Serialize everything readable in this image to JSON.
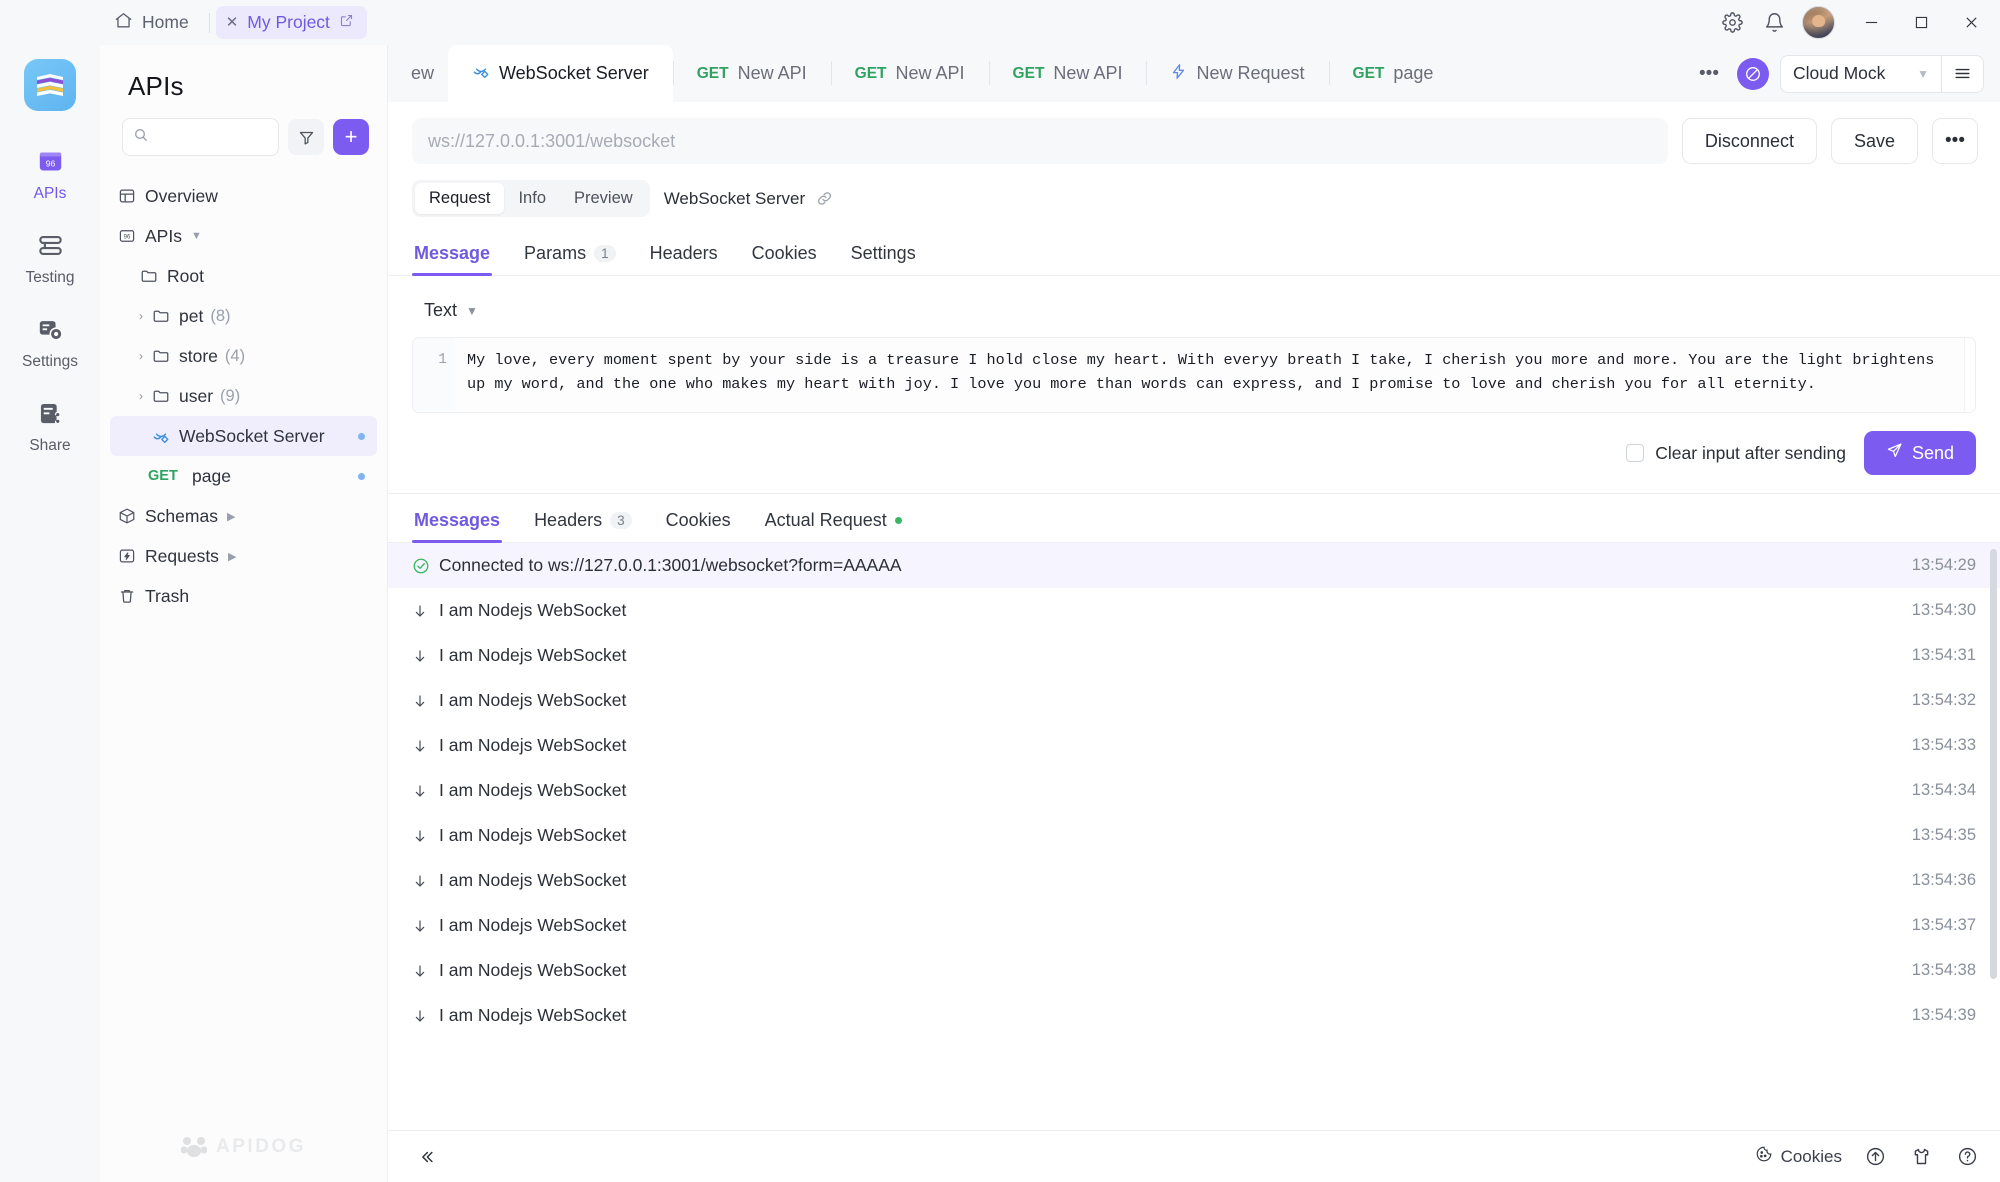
{
  "titlebar": {
    "home_label": "Home",
    "project_tab": "My Project",
    "icons": [
      "gear-icon",
      "bell-icon",
      "avatar"
    ],
    "window_controls": [
      "minimize",
      "maximize",
      "close"
    ]
  },
  "rail": {
    "items": [
      {
        "label": "APIs",
        "icon": "apis-icon",
        "active": true
      },
      {
        "label": "Testing",
        "icon": "testing-icon",
        "active": false
      },
      {
        "label": "Settings",
        "icon": "settings-icon",
        "active": false
      },
      {
        "label": "Share",
        "icon": "share-icon",
        "active": false
      }
    ]
  },
  "sidebar": {
    "title": "APIs",
    "search_placeholder": "",
    "filter_icon": "filter-icon",
    "add_label": "+",
    "watermark": "APIDOG",
    "tree": [
      {
        "label": "Overview",
        "icon": "overview-icon",
        "indent": 0,
        "type": "item"
      },
      {
        "label": "APIs",
        "icon": "apis-small-icon",
        "indent": 0,
        "type": "group",
        "caret": "down"
      },
      {
        "label": "Root",
        "icon": "folder-icon",
        "indent": 1,
        "type": "folder"
      },
      {
        "label": "pet",
        "count": "(8)",
        "icon": "folder-icon",
        "indent": 2,
        "type": "folder",
        "caret": "right"
      },
      {
        "label": "store",
        "count": "(4)",
        "icon": "folder-icon",
        "indent": 2,
        "type": "folder",
        "caret": "right"
      },
      {
        "label": "user",
        "count": "(9)",
        "icon": "folder-icon",
        "indent": 2,
        "type": "folder",
        "caret": "right"
      },
      {
        "label": "WebSocket Server",
        "icon": "websocket-icon",
        "indent": 2,
        "type": "endpoint",
        "selected": true,
        "dot": true
      },
      {
        "label": "page",
        "method": "GET",
        "indent": 2,
        "type": "endpoint",
        "dot": true
      },
      {
        "label": "Schemas",
        "icon": "schemas-icon",
        "indent": 0,
        "type": "group",
        "caret": "right"
      },
      {
        "label": "Requests",
        "icon": "requests-icon",
        "indent": 0,
        "type": "group",
        "caret": "right"
      },
      {
        "label": "Trash",
        "icon": "trash-icon",
        "indent": 0,
        "type": "item"
      }
    ]
  },
  "tabstrip": {
    "partial_left_tab": "ew",
    "tabs": [
      {
        "label": "WebSocket Server",
        "icon": "websocket-icon",
        "active": true
      },
      {
        "label": "New API",
        "method": "GET",
        "active": false
      },
      {
        "label": "New API",
        "method": "GET",
        "active": false
      },
      {
        "label": "New API",
        "method": "GET",
        "active": false
      },
      {
        "label": "New Request",
        "icon": "lightning-icon",
        "active": false
      },
      {
        "label": "page",
        "method": "GET",
        "active": false
      }
    ],
    "overflow_icon": "more-horizontal-icon",
    "env_badge_icon": "mock-icon",
    "env_value": "Cloud Mock",
    "menu_icon": "hamburger-icon"
  },
  "urlbar": {
    "url_placeholder": "ws://127.0.0.1:3001/websocket",
    "url_value": "",
    "disconnect_label": "Disconnect",
    "save_label": "Save",
    "more_label": "•••"
  },
  "request_pills": {
    "items": [
      "Request",
      "Info",
      "Preview"
    ],
    "active": "Request",
    "ws_name": "WebSocket Server",
    "link_icon": "link-icon"
  },
  "request_tabs": {
    "items": [
      {
        "label": "Message",
        "badge": "",
        "active": true
      },
      {
        "label": "Params",
        "badge": "1",
        "active": false
      },
      {
        "label": "Headers",
        "badge": "",
        "active": false
      },
      {
        "label": "Cookies",
        "badge": "",
        "active": false
      },
      {
        "label": "Settings",
        "badge": "",
        "active": false
      }
    ]
  },
  "editor": {
    "format": "Text",
    "line_number": "1",
    "content": "My love, every moment spent by your side is a treasure I hold close my heart. With everyy breath I take, I cherish you more and more. You are the light brightens up my word, and the one who makes my heart with joy. I love you more than words can express, and I promise to love and cherish you for all eternity.",
    "clear_input_label": "Clear input after sending",
    "clear_input_checked": false,
    "send_label": "Send",
    "send_icon": "send-icon"
  },
  "response_tabs": {
    "items": [
      {
        "label": "Messages",
        "badge": "",
        "dot": false,
        "active": true
      },
      {
        "label": "Headers",
        "badge": "3",
        "dot": false,
        "active": false
      },
      {
        "label": "Cookies",
        "badge": "",
        "dot": false,
        "active": false
      },
      {
        "label": "Actual Request",
        "badge": "",
        "dot": true,
        "active": false
      }
    ]
  },
  "messages": [
    {
      "icon": "check-circle-icon",
      "text": "Connected to ws://127.0.0.1:3001/websocket?form=AAAAA",
      "time": "13:54:29",
      "kind": "connected"
    },
    {
      "icon": "arrow-down-icon",
      "text": "I am Nodejs WebSocket",
      "time": "13:54:30",
      "kind": "received"
    },
    {
      "icon": "arrow-down-icon",
      "text": "I am Nodejs WebSocket",
      "time": "13:54:31",
      "kind": "received"
    },
    {
      "icon": "arrow-down-icon",
      "text": "I am Nodejs WebSocket",
      "time": "13:54:32",
      "kind": "received"
    },
    {
      "icon": "arrow-down-icon",
      "text": "I am Nodejs WebSocket",
      "time": "13:54:33",
      "kind": "received"
    },
    {
      "icon": "arrow-down-icon",
      "text": "I am Nodejs WebSocket",
      "time": "13:54:34",
      "kind": "received"
    },
    {
      "icon": "arrow-down-icon",
      "text": "I am Nodejs WebSocket",
      "time": "13:54:35",
      "kind": "received"
    },
    {
      "icon": "arrow-down-icon",
      "text": "I am Nodejs WebSocket",
      "time": "13:54:36",
      "kind": "received"
    },
    {
      "icon": "arrow-down-icon",
      "text": "I am Nodejs WebSocket",
      "time": "13:54:37",
      "kind": "received"
    },
    {
      "icon": "arrow-down-icon",
      "text": "I am Nodejs WebSocket",
      "time": "13:54:38",
      "kind": "received"
    },
    {
      "icon": "arrow-down-icon",
      "text": "I am Nodejs WebSocket",
      "time": "13:54:39",
      "kind": "received"
    }
  ],
  "footer": {
    "collapse_icon": "chevron-double-left-icon",
    "cookies_label": "Cookies",
    "icons": [
      "upload-circle-icon",
      "shirt-icon",
      "help-circle-icon"
    ]
  },
  "colors": {
    "accent": "#7c5cf0",
    "accent_soft": "#f0edfd",
    "method_get": "#2fa360",
    "connected_bg": "#f6f4fe",
    "sidebar_bg": "#fcfcfd",
    "chrome_bg": "#f7f8fa",
    "text": "#2b2f37",
    "muted": "#8a909b"
  }
}
